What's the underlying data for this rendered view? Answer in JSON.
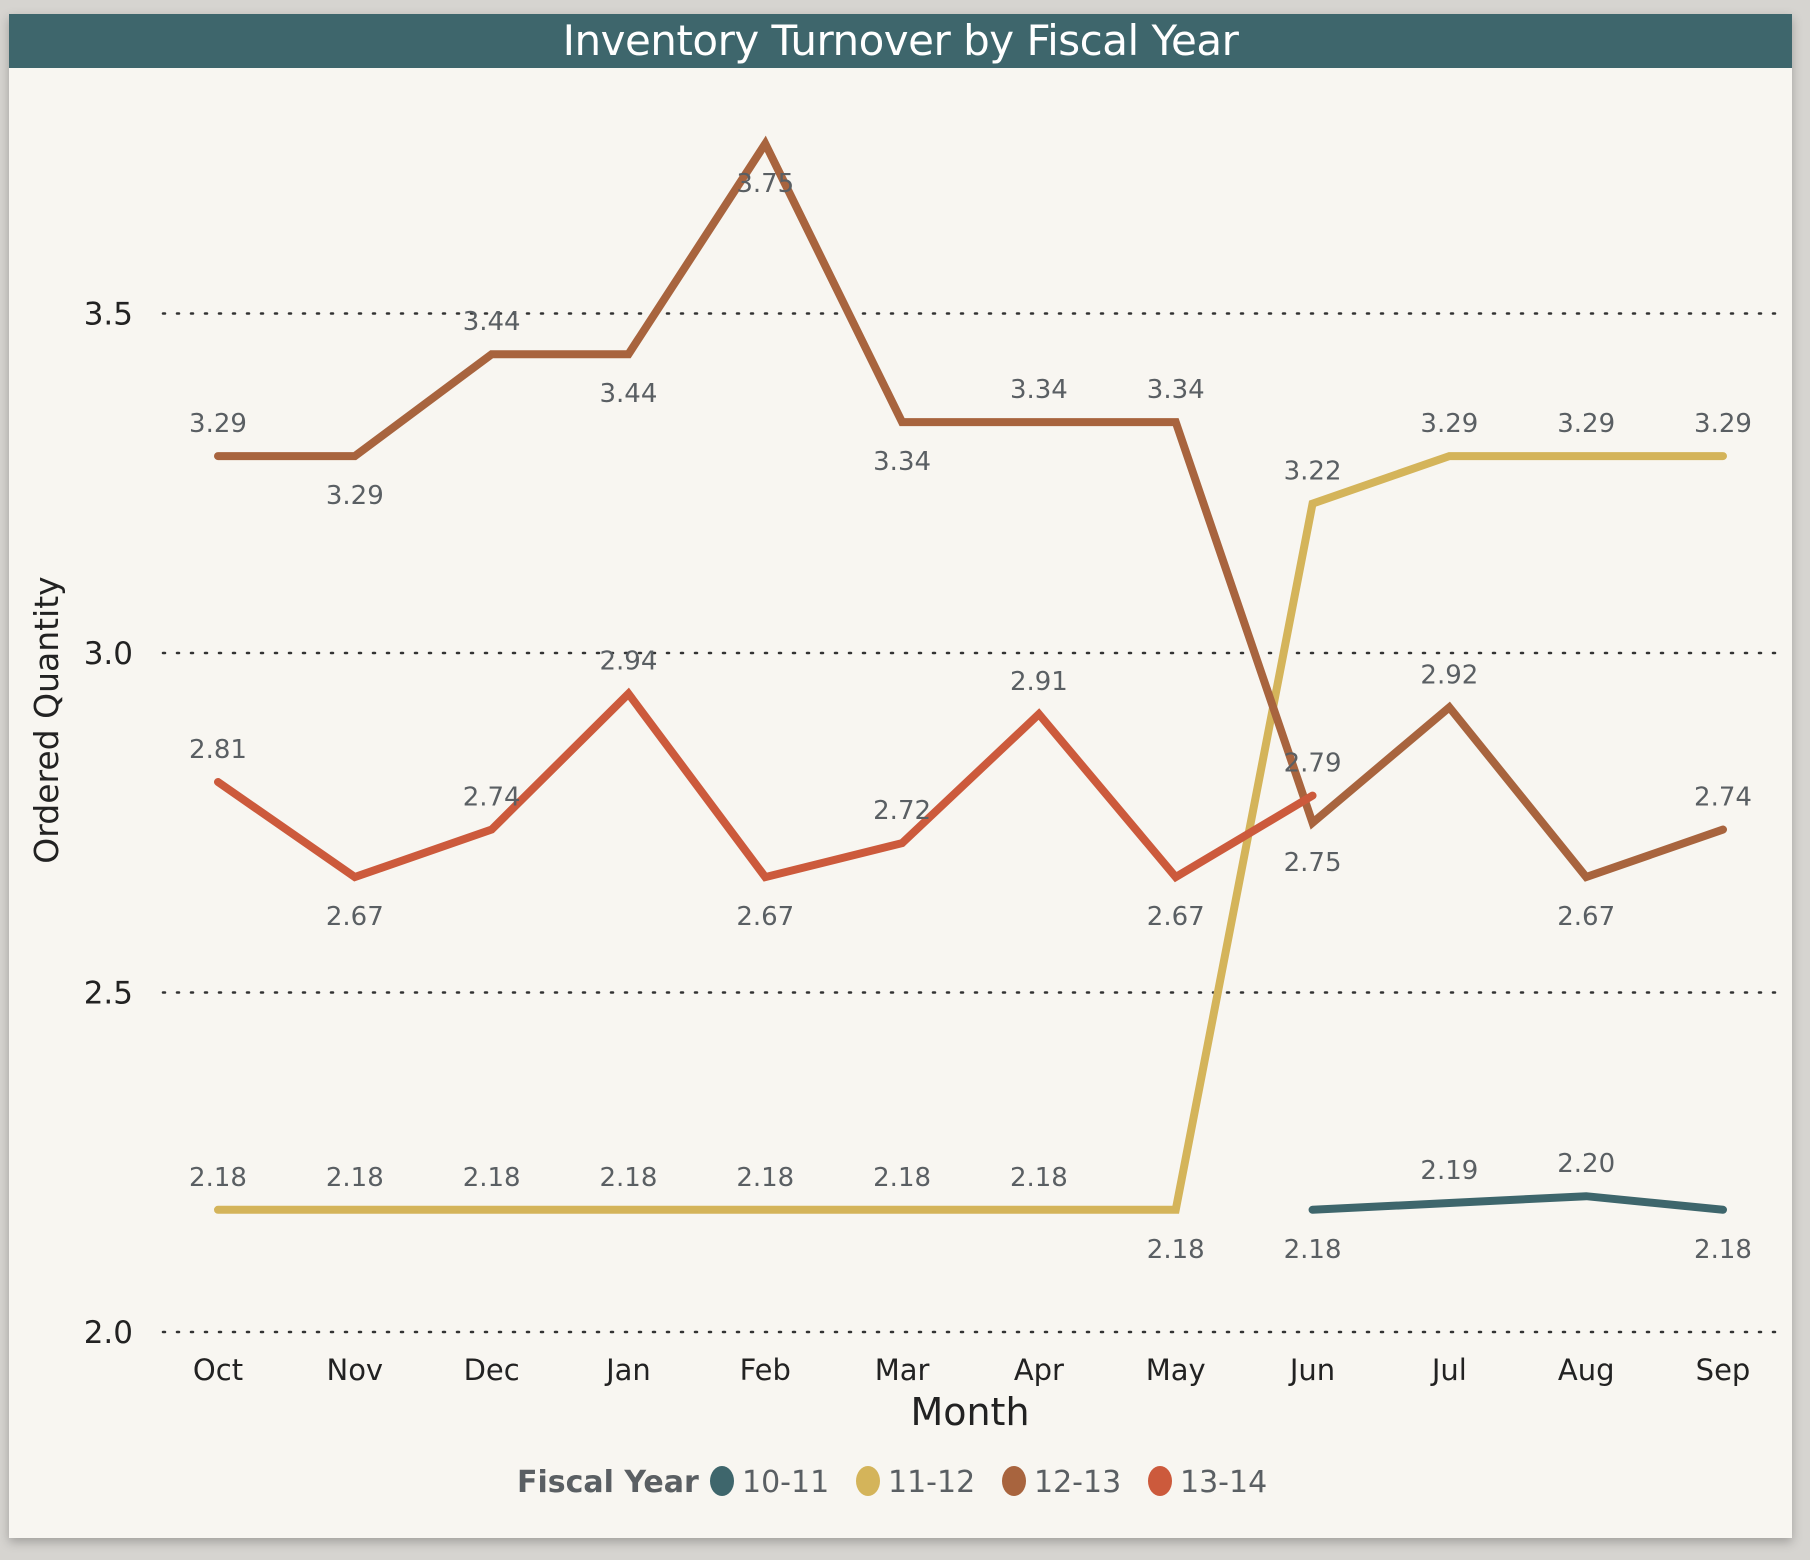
{
  "chart_data": {
    "type": "line",
    "title": "Inventory Turnover by Fiscal Year",
    "xlabel": "Month",
    "ylabel": "Ordered Quantity",
    "categories": [
      "Oct",
      "Nov",
      "Dec",
      "Jan",
      "Feb",
      "Mar",
      "Apr",
      "May",
      "Jun",
      "Jul",
      "Aug",
      "Sep"
    ],
    "ylim": [
      2.0,
      3.8
    ],
    "yticks": [
      2.0,
      2.5,
      3.0,
      3.5
    ],
    "ytick_labels": [
      "2.0",
      "2.5",
      "3.0",
      "3.5"
    ],
    "grid": true,
    "legend": {
      "title": "Fiscal Year",
      "position": "bottom-center"
    },
    "series": [
      {
        "name": "10-11",
        "color": "#3e666c",
        "values": [
          null,
          null,
          null,
          null,
          null,
          null,
          null,
          null,
          2.18,
          2.19,
          2.2,
          2.18
        ],
        "labels": [
          "",
          "",
          "",
          "",
          "",
          "",
          "",
          "",
          "2.18",
          "2.19",
          "2.20",
          "2.18"
        ],
        "label_pos": [
          "",
          "",
          "",
          "",
          "",
          "",
          "",
          "",
          "below",
          "above",
          "above",
          "below"
        ]
      },
      {
        "name": "11-12",
        "color": "#d4b45a",
        "values": [
          2.18,
          2.18,
          2.18,
          2.18,
          2.18,
          2.18,
          2.18,
          2.18,
          3.22,
          3.29,
          3.29,
          3.29
        ],
        "labels": [
          "2.18",
          "2.18",
          "2.18",
          "2.18",
          "2.18",
          "2.18",
          "2.18",
          "2.18",
          "3.22",
          "3.29",
          "3.29",
          "3.29"
        ],
        "label_pos": [
          "above",
          "above",
          "above",
          "above",
          "above",
          "above",
          "above",
          "below",
          "above",
          "above",
          "above",
          "above"
        ]
      },
      {
        "name": "12-13",
        "color": "#a8643e",
        "values": [
          3.29,
          3.29,
          3.44,
          3.44,
          3.75,
          3.34,
          3.34,
          3.34,
          2.75,
          2.92,
          2.67,
          2.74
        ],
        "labels": [
          "3.29",
          "3.29",
          "3.44",
          "3.44",
          "3.75",
          "3.34",
          "3.34",
          "3.34",
          "2.75",
          "2.92",
          "2.67",
          "2.74"
        ],
        "label_pos": [
          "above",
          "below",
          "above",
          "below",
          "below",
          "below",
          "above",
          "above",
          "below",
          "above",
          "below",
          "above"
        ]
      },
      {
        "name": "13-14",
        "color": "#cc5a3c",
        "values": [
          2.81,
          2.67,
          2.74,
          2.94,
          2.67,
          2.72,
          2.91,
          2.67,
          2.79,
          null,
          null,
          null
        ],
        "labels": [
          "2.81",
          "2.67",
          "2.74",
          "2.94",
          "2.67",
          "2.72",
          "2.91",
          "2.67",
          "2.79",
          "",
          "",
          ""
        ],
        "label_pos": [
          "above",
          "below",
          "above",
          "above",
          "below",
          "above",
          "above",
          "below",
          "above",
          "",
          "",
          ""
        ]
      }
    ]
  }
}
